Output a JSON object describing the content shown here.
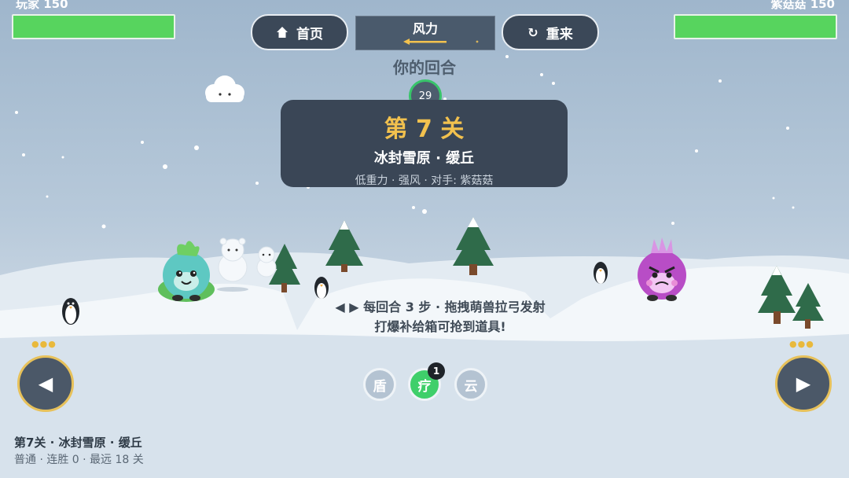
{
  "player": {
    "name": "玩家",
    "hp": 150
  },
  "enemy": {
    "name": "紫菇菇",
    "hp": 150
  },
  "nav": {
    "home_label": "首页",
    "restart_label": "重来",
    "home_icon": "house-icon",
    "restart_icon": "refresh-icon"
  },
  "wind": {
    "label": "风力",
    "direction": "left",
    "strength": 0.35
  },
  "turn": {
    "text": "你的回合",
    "timer": "29"
  },
  "level_card": {
    "title": "第 7 关",
    "name": "冰封雪原 · 缓丘",
    "details": "低重力 · 强风 · 对手: 紫菇菇"
  },
  "tip": {
    "line1": "◀ ▶ 每回合 3 步 · 拖拽萌兽拉弓发射",
    "line2": "打爆补给箱可抢到道具!"
  },
  "skills": [
    {
      "label": "盾",
      "badge": "",
      "active": false
    },
    {
      "label": "疗",
      "badge": "1",
      "active": true
    },
    {
      "label": "云",
      "badge": "",
      "active": false
    }
  ],
  "controls": {
    "left_icon": "left-arrow-icon",
    "right_icon": "right-arrow-icon",
    "left_stars": 3,
    "right_stars": 3
  },
  "footer": {
    "line1": "第7关 · 冰封雪原 · 缓丘",
    "line2": "普通 · 连胜 0 · 最远 18 关"
  },
  "colors": {
    "hp_bar": "#57d45e",
    "accent_gold": "#f2c14e",
    "timer_ring": "#38c46a",
    "active_skill": "#3fcf6a",
    "card_bg": "#3a4656"
  }
}
